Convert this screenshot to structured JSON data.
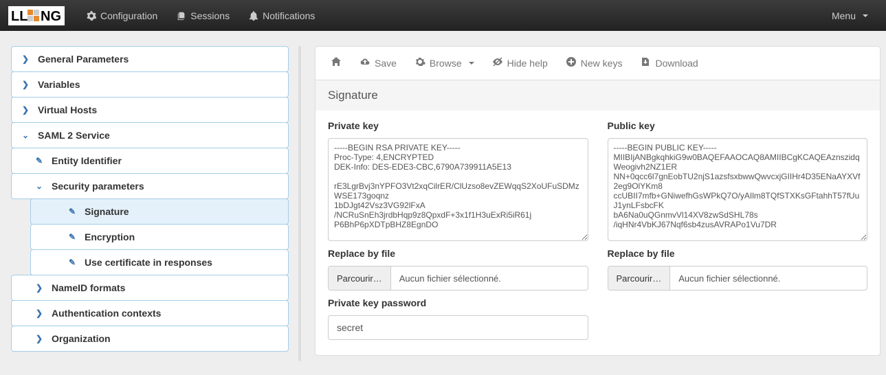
{
  "nav": {
    "configuration": "Configuration",
    "sessions": "Sessions",
    "notifications": "Notifications",
    "menu": "Menu"
  },
  "tree": {
    "general": "General Parameters",
    "variables": "Variables",
    "vhosts": "Virtual Hosts",
    "saml": "SAML 2 Service",
    "saml_entity": "Entity Identifier",
    "saml_security": "Security parameters",
    "saml_sig": "Signature",
    "saml_enc": "Encryption",
    "saml_cert": "Use certificate in responses",
    "saml_nameid": "NameID formats",
    "saml_auth": "Authentication contexts",
    "saml_org": "Organization"
  },
  "toolbar": {
    "save": "Save",
    "browse": "Browse",
    "hidehelp": "Hide help",
    "newkeys": "New keys",
    "download": "Download"
  },
  "section": {
    "title": "Signature",
    "private_label": "Private key",
    "public_label": "Public key",
    "replace_label": "Replace by file",
    "file_button": "Parcourir…",
    "file_none": "Aucun fichier sélectionné.",
    "pkpass_label": "Private key password",
    "pkpass_value": "secret",
    "private_value": "-----BEGIN RSA PRIVATE KEY-----\nProc-Type: 4,ENCRYPTED\nDEK-Info: DES-EDE3-CBC,6790A739911A5E13\n\nrE3LgrBvj3nYPFO3Vt2xqCilrER/ClUzso8evZEWqqS2XoUFuSDMzWSE173goqnz\n1bDJgt42Vsz3VG92lFxA\n/NCRuSnEh3jrdbHqp9z8QpxdF+3x1f1H3uExRi5iR61j\nP6BhP6pXDTpBHZ8EgnDO",
    "public_value": "-----BEGIN PUBLIC KEY-----\nMIIBIjANBgkqhkiG9w0BAQEFAAOCAQ8AMIIBCgKCAQEAznszidqWeogivh2NZ1ER\nNN+0qcc6l7gnEobTU2njS1azsfsxbwwQwvcxjGIIHr4D35ENaAYXVf2eg9OlYKm8\nccUBII7mfb+GNiwefhGsWPkQ7O/yAIlm8TQfSTXKsGFtahhT57fUuJ1ynLFsbcFK\nbA6Na0uQGnmvVl14XV8zwSdSHL78s\n/iqHNr4VbKJ67Nqf6sb4zusAVRAPo1Vu7DR"
  }
}
